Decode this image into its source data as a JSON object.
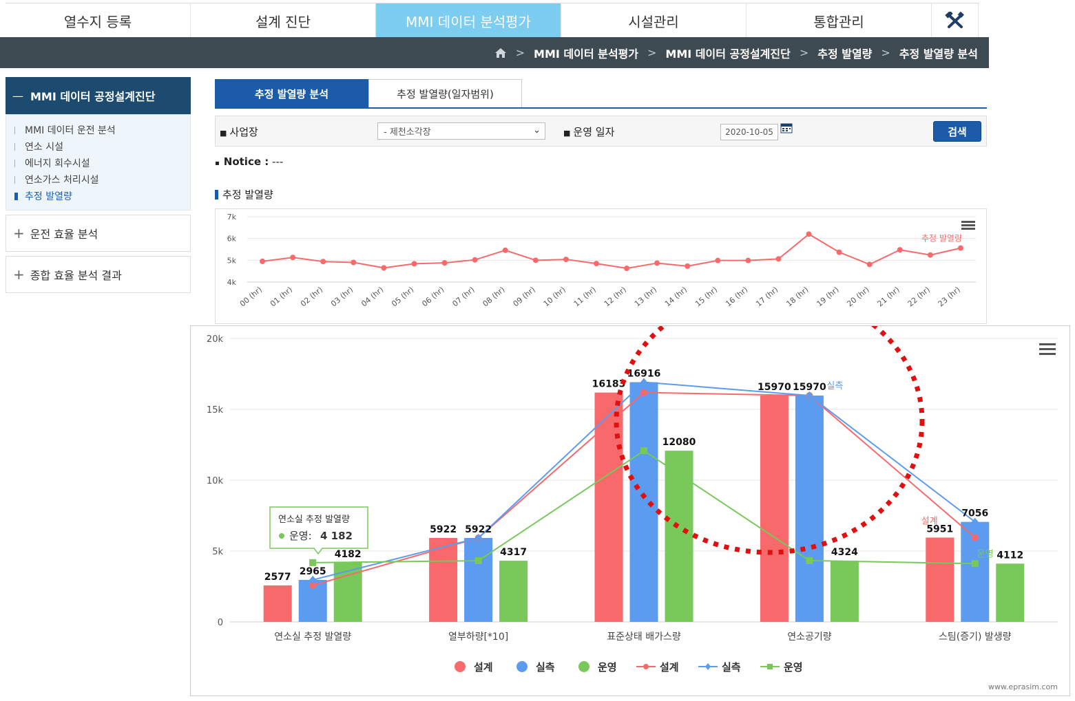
{
  "topnav": {
    "tabs": [
      {
        "label": "열수지 등록",
        "active": false
      },
      {
        "label": "설계 진단",
        "active": false
      },
      {
        "label": "MMI 데이터 분석평가",
        "active": true
      },
      {
        "label": "시설관리",
        "active": false
      },
      {
        "label": "통합관리",
        "active": false
      }
    ],
    "tool_icon": "tools-icon"
  },
  "breadcrumb": {
    "home_icon": "home-icon",
    "items": [
      "MMI 데이터 분석평가",
      "MMI 데이터 공정설계진단",
      "추정 발열량",
      "추정 발열량 분석"
    ]
  },
  "sidebar": {
    "section_title": "MMI 데이터 공정설계진단",
    "items": [
      {
        "label": "MMI 데이터 운전 분석",
        "active": false
      },
      {
        "label": "연소 시설",
        "active": false
      },
      {
        "label": "에너지 회수시설",
        "active": false
      },
      {
        "label": "연소가스 처리시설",
        "active": false
      },
      {
        "label": "추정 발열량",
        "active": true
      }
    ],
    "groups": [
      {
        "label": "운전 효율 분석"
      },
      {
        "label": "종합 효율 분석 결과"
      }
    ]
  },
  "subtabs": [
    {
      "label": "추정 발열량 분석",
      "active": true
    },
    {
      "label": "추정 발열량(일자범위)",
      "active": false
    }
  ],
  "search": {
    "site_label": "사업장",
    "site_value": "- 제천소각장",
    "date_label": "운영 일자",
    "date_value": "2020-10-05",
    "button": "검색"
  },
  "notice": {
    "label": "Notice :",
    "text": "---"
  },
  "section_title": "추정 발열량",
  "colors": {
    "design": "#f8696b",
    "measured": "#5b9bf0",
    "operation": "#78c85a",
    "primary": "#1b5ba7",
    "nav_active": "#7ccdf0"
  },
  "chart_data": [
    {
      "type": "line",
      "x": [
        "00 (hr)",
        "01 (hr)",
        "02 (hr)",
        "03 (hr)",
        "04 (hr)",
        "05 (hr)",
        "06 (hr)",
        "07 (hr)",
        "08 (hr)",
        "09 (hr)",
        "10 (hr)",
        "11 (hr)",
        "12 (hr)",
        "13 (hr)",
        "14 (hr)",
        "15 (hr)",
        "16 (hr)",
        "17 (hr)",
        "18 (hr)",
        "19 (hr)",
        "20 (hr)",
        "21 (hr)",
        "22 (hr)",
        "23 (hr)"
      ],
      "series": [
        {
          "name": "추정 발열량",
          "values": [
            4950,
            5130,
            4940,
            4900,
            4650,
            4840,
            4880,
            5020,
            5460,
            5000,
            5040,
            4850,
            4630,
            4870,
            4730,
            4990,
            4990,
            5060,
            6200,
            5370,
            4810,
            5480,
            5240,
            5560
          ]
        }
      ],
      "ylim": [
        4000,
        7000
      ],
      "yticks": [
        "4k",
        "5k",
        "6k",
        "7k"
      ],
      "grid": true,
      "menu_icon": "hamburger-icon"
    },
    {
      "type": "bar",
      "categories": [
        "연소실 추정 발열량",
        "열부하량[*10]",
        "표준상태 배가스량",
        "연소공기량",
        "스팀(증기) 발생량"
      ],
      "series": [
        {
          "name": "설계",
          "values": [
            2577,
            5922,
            16183,
            15970,
            5951
          ]
        },
        {
          "name": "실측",
          "values": [
            2965,
            5922,
            16916,
            15970,
            7056
          ]
        },
        {
          "name": "운영",
          "values": [
            4182,
            4317,
            12080,
            4324,
            4112
          ]
        }
      ],
      "line_series": [
        {
          "name": "설계",
          "values": [
            2577,
            5922,
            16183,
            15970,
            5951
          ]
        },
        {
          "name": "실측",
          "values": [
            2965,
            5922,
            16916,
            15970,
            7056
          ]
        },
        {
          "name": "운영",
          "values": [
            4182,
            4317,
            12080,
            4324,
            4112
          ]
        }
      ],
      "inline_labels": {
        "measured": "실측",
        "design": "설계",
        "operation": "운영"
      },
      "ylim": [
        0,
        20000
      ],
      "yticks": [
        "0",
        "5k",
        "10k",
        "15k",
        "20k"
      ],
      "legend": [
        "설계",
        "실측",
        "운영",
        "설계",
        "실측",
        "운영"
      ],
      "legend_position": "bottom",
      "tooltip": {
        "title": "연소실 추정 발열량",
        "series": "운영",
        "value": "4 182"
      },
      "credit": "www.eprasim.com",
      "menu_icon": "hamburger-icon"
    }
  ]
}
